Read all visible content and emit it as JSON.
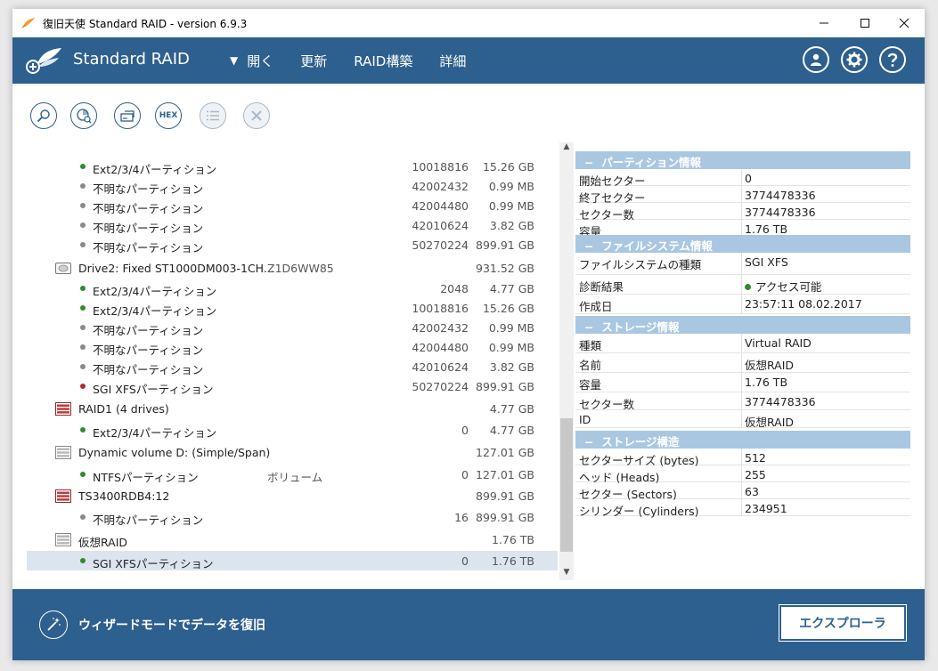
{
  "window": {
    "title": "復旧天使 Standard RAID - version 6.9.3"
  },
  "header": {
    "brand": "Standard RAID",
    "menu": [
      "開く",
      "更新",
      "RAID構築",
      "詳細"
    ]
  },
  "tree": {
    "rows": [
      {
        "type": "partition",
        "status": "green",
        "name": "Ext2/3/4パーティション",
        "start": "10018816",
        "size": "15.26 GB"
      },
      {
        "type": "partition",
        "status": "gray",
        "name": "不明なパーティション",
        "start": "42002432",
        "size": "0.99 MB"
      },
      {
        "type": "partition",
        "status": "gray",
        "name": "不明なパーティション",
        "start": "42004480",
        "size": "0.99 MB"
      },
      {
        "type": "partition",
        "status": "gray",
        "name": "不明なパーティション",
        "start": "42010624",
        "size": "3.82 GB"
      },
      {
        "type": "partition",
        "status": "gray",
        "name": "不明なパーティション",
        "start": "50270224",
        "size": "899.91 GB"
      },
      {
        "type": "drive",
        "icon": "hdd",
        "name": "Drive2: Fixed ST1000DM003-1CH...",
        "extra": "Z1D6WW85",
        "start": "",
        "size": "931.52 GB"
      },
      {
        "type": "partition",
        "status": "green",
        "name": "Ext2/3/4パーティション",
        "start": "2048",
        "size": "4.77 GB"
      },
      {
        "type": "partition",
        "status": "green",
        "name": "Ext2/3/4パーティション",
        "start": "10018816",
        "size": "15.26 GB"
      },
      {
        "type": "partition",
        "status": "gray",
        "name": "不明なパーティション",
        "start": "42002432",
        "size": "0.99 MB"
      },
      {
        "type": "partition",
        "status": "gray",
        "name": "不明なパーティション",
        "start": "42004480",
        "size": "0.99 MB"
      },
      {
        "type": "partition",
        "status": "gray",
        "name": "不明なパーティション",
        "start": "42010624",
        "size": "3.82 GB"
      },
      {
        "type": "partition",
        "status": "red",
        "name": "SGI XFSパーティション",
        "start": "50270224",
        "size": "899.91 GB"
      },
      {
        "type": "drive",
        "icon": "raid",
        "name": "RAID1 (4 drives)",
        "extra": "",
        "start": "",
        "size": "4.77 GB"
      },
      {
        "type": "partition",
        "status": "green",
        "name": "Ext2/3/4パーティション",
        "start": "0",
        "size": "4.77 GB"
      },
      {
        "type": "drive",
        "icon": "volume",
        "name": "Dynamic volume D: (Simple/Span)",
        "extra": "",
        "start": "",
        "size": "127.01 GB"
      },
      {
        "type": "partition",
        "status": "green",
        "name": "NTFSパーティション",
        "extra": "ボリューム",
        "start": "0",
        "size": "127.01 GB"
      },
      {
        "type": "drive",
        "icon": "raid",
        "name": "TS3400RDB4:12",
        "extra": "",
        "start": "",
        "size": "899.91 GB"
      },
      {
        "type": "partition",
        "status": "gray",
        "name": "不明なパーティション",
        "start": "16",
        "size": "899.91 GB"
      },
      {
        "type": "drive",
        "icon": "volume",
        "name": "仮想RAID",
        "extra": "",
        "start": "",
        "size": "1.76 TB"
      },
      {
        "type": "partition",
        "status": "green",
        "name": "SGI XFSパーティション",
        "start": "0",
        "size": "1.76 TB",
        "selected": true
      }
    ]
  },
  "props": {
    "sections": [
      {
        "title": "パーティション情報",
        "rows": [
          {
            "k": "開始セクター",
            "v": "0"
          },
          {
            "k": "終了セクター",
            "v": "3774478336"
          },
          {
            "k": "セクター数",
            "v": "3774478336"
          },
          {
            "k": "容量",
            "v": "1.76 TB"
          }
        ]
      },
      {
        "title": "ファイルシステム情報",
        "rows": [
          {
            "k": "ファイルシステムの種類",
            "v": "SGI XFS"
          },
          {
            "k": "診断結果",
            "v": "アクセス可能",
            "ok": true
          },
          {
            "k": "作成日",
            "v": "23:57:11 08.02.2017"
          }
        ]
      },
      {
        "title": "ストレージ情報",
        "rows": [
          {
            "k": "種類",
            "v": "Virtual RAID"
          },
          {
            "k": "名前",
            "v": "仮想RAID"
          },
          {
            "k": "容量",
            "v": "1.76 TB"
          },
          {
            "k": "セクター数",
            "v": "3774478336"
          },
          {
            "k": "ID",
            "v": "仮想RAID"
          }
        ]
      },
      {
        "title": "ストレージ構造",
        "rows": [
          {
            "k": "セクターサイズ (bytes)",
            "v": "512"
          },
          {
            "k": "ヘッド (Heads)",
            "v": "255"
          },
          {
            "k": "セクター (Sectors)",
            "v": "63"
          },
          {
            "k": "シリンダー (Cylinders)",
            "v": "234951"
          }
        ]
      }
    ]
  },
  "footer": {
    "wizard_label": "ウィザードモードでデータを復旧",
    "explorer_label": "エクスプローラ"
  },
  "colors": {
    "accent": "#2d5f8f",
    "section": "#aac7e2",
    "ok": "#2e8b2e",
    "error": "#b52b2b"
  }
}
